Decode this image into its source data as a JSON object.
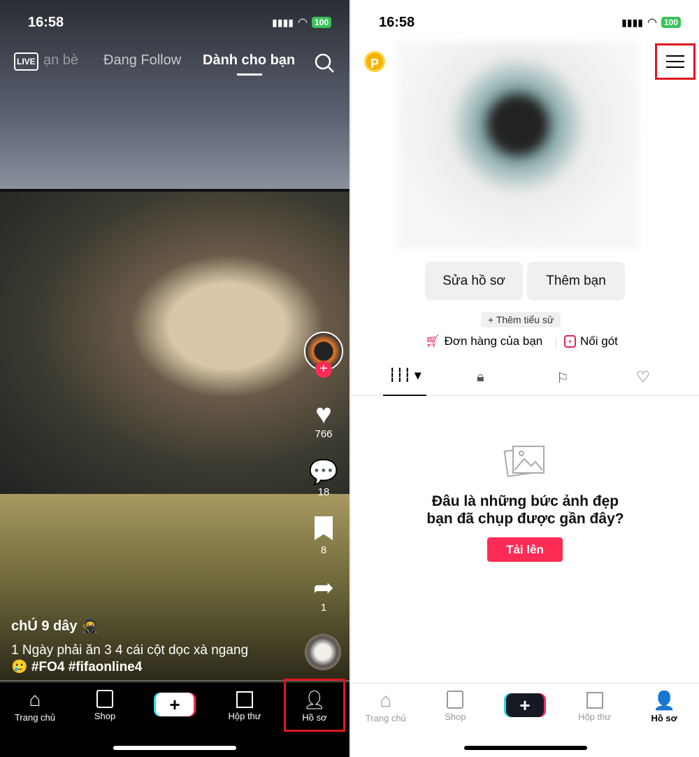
{
  "status": {
    "time": "16:58",
    "battery": "100"
  },
  "feed": {
    "tabs": [
      "ạn bè",
      "Đang Follow",
      "Dành cho bạn"
    ],
    "live_label": "LIVE",
    "likes": "766",
    "comments": "18",
    "saves": "8",
    "shares": "1",
    "author": "chÚ 9 dây 🥷",
    "caption_line1": "1 Ngày phải ăn 3 4 cái cột dọc xà ngang",
    "caption_line2": "🥲 #FO4 #fifaonline4"
  },
  "profile": {
    "edit_label": "Sửa hồ sơ",
    "add_friend_label": "Thêm bạn",
    "add_bio_label": "+ Thêm tiểu sử",
    "orders_label": "Đơn hàng của bạn",
    "extend_label": "Nối gót",
    "points_badge": "P",
    "empty_title_line1": "Đâu là những bức ảnh đẹp",
    "empty_title_line2": "bạn đã chụp được gần đây?",
    "upload_label": "Tải lên"
  },
  "tabbar": {
    "items": [
      "Trang chủ",
      "Shop",
      "",
      "Hộp thư",
      "Hồ sơ"
    ]
  },
  "colors": {
    "accent": "#fe2c55",
    "highlight": "#e0161e",
    "battery": "#3ac35a"
  }
}
